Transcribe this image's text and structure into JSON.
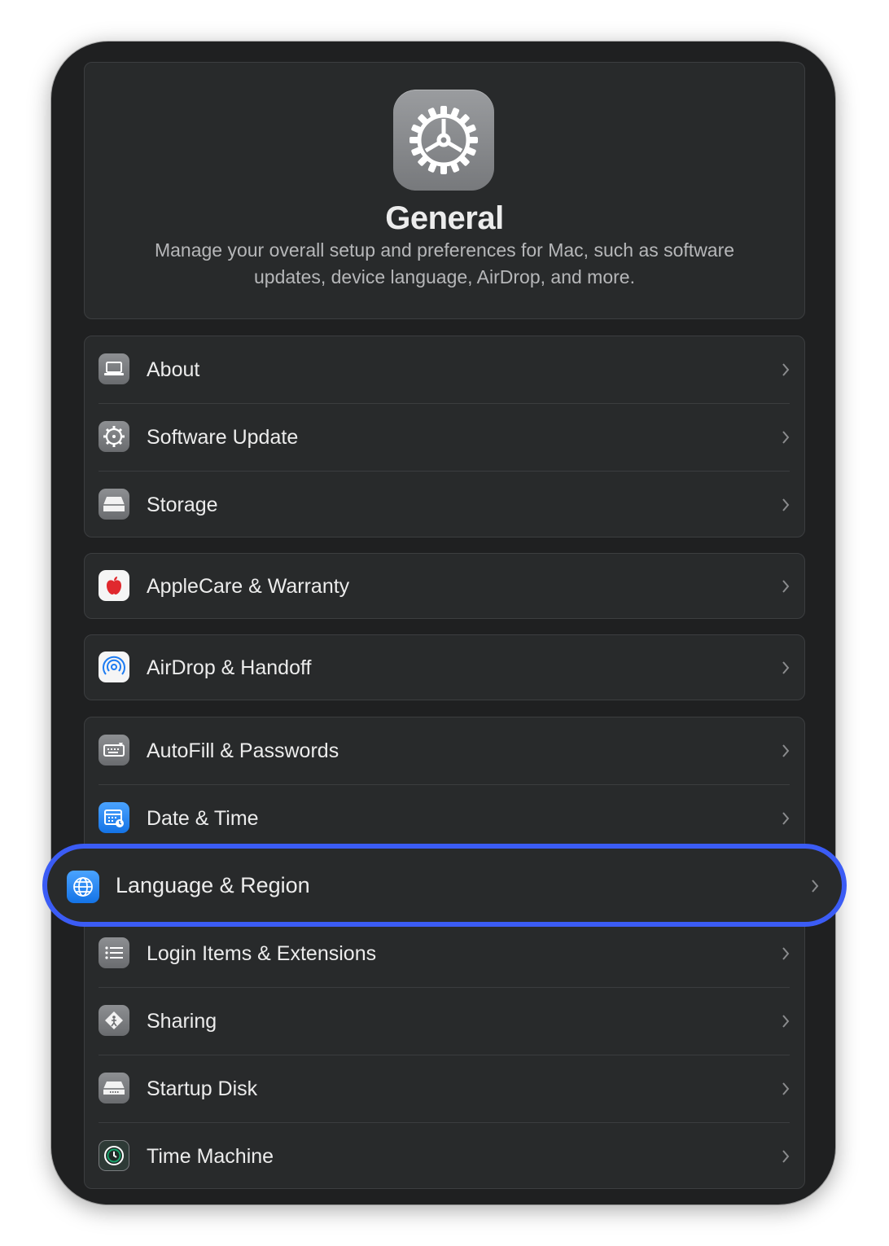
{
  "header": {
    "icon": "gear-icon",
    "title": "General",
    "description": "Manage your overall setup and preferences for Mac, such as software updates, device language, AirDrop, and more."
  },
  "groups": [
    {
      "items": [
        {
          "label": "About",
          "icon": "laptop-icon"
        },
        {
          "label": "Software Update",
          "icon": "gear-update-icon"
        },
        {
          "label": "Storage",
          "icon": "drive-icon"
        }
      ]
    },
    {
      "items": [
        {
          "label": "AppleCare & Warranty",
          "icon": "apple-icon"
        }
      ]
    },
    {
      "items": [
        {
          "label": "AirDrop & Handoff",
          "icon": "airdrop-icon"
        }
      ]
    },
    {
      "items": [
        {
          "label": "AutoFill & Passwords",
          "icon": "keyboard-icon"
        },
        {
          "label": "Date & Time",
          "icon": "calendar-clock-icon"
        },
        {
          "label": "Language & Region",
          "icon": "globe-icon",
          "highlighted": true
        },
        {
          "label": "Login Items & Extensions",
          "icon": "list-icon"
        },
        {
          "label": "Sharing",
          "icon": "sharing-icon"
        },
        {
          "label": "Startup Disk",
          "icon": "disk-icon"
        },
        {
          "label": "Time Machine",
          "icon": "time-machine-icon"
        }
      ]
    }
  ],
  "colors": {
    "highlight_ring": "#3b5cf5",
    "background": "#1f2021",
    "card": "#282a2b"
  }
}
